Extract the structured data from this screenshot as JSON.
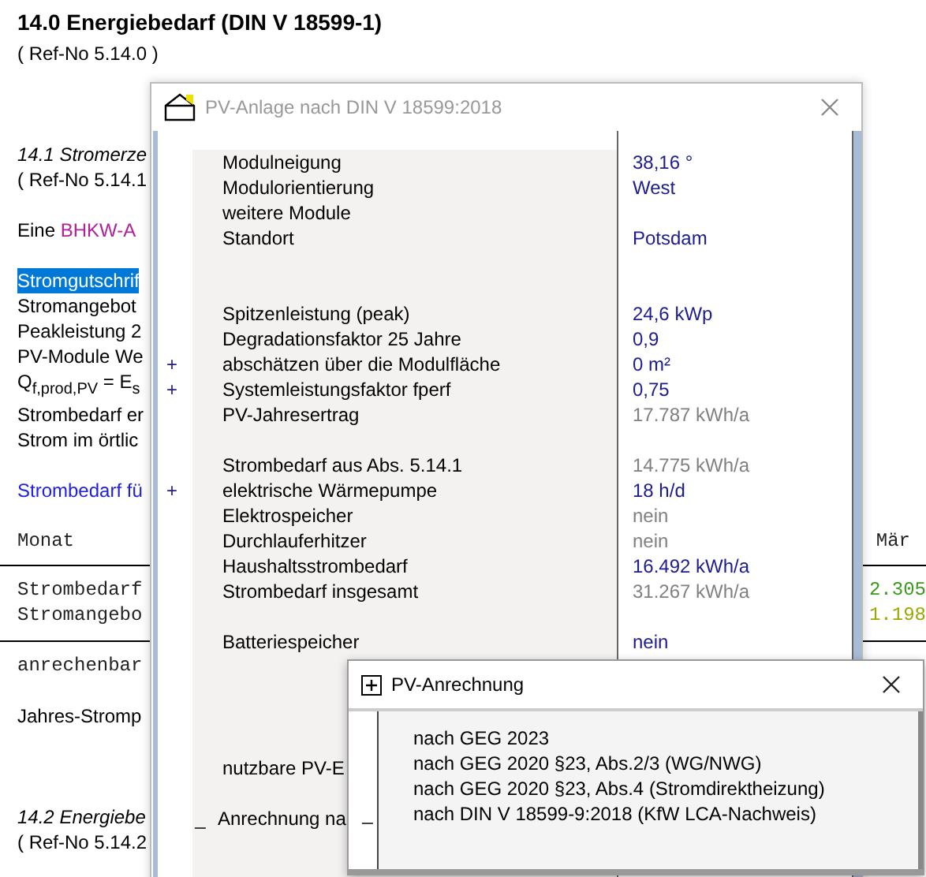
{
  "document": {
    "heading": "14.0 Energiebedarf (DIN V 18599-1)",
    "heading_ref": "( Ref-No 5.14.0 )",
    "subsection": {
      "title": "14.1 Stromerze",
      "ref": "( Ref-No 5.14.1"
    },
    "intro_text": "Eine",
    "intro_link": "BHKW-A",
    "lines": [
      {
        "text": "Stromgutschrif",
        "selected": true
      },
      {
        "text": "Stromangebot",
        "selected": false
      },
      {
        "text": "Peakleistung 2",
        "selected": false
      },
      {
        "text": "PV-Module We",
        "selected": false
      },
      {
        "text": "Q$_{f,prod,PV}$ = E$_{s}$",
        "selected": false
      },
      {
        "text": "Strombedarf er",
        "selected": false
      },
      {
        "text": "Strom im örtlic",
        "selected": false
      }
    ],
    "link_line": "Strombedarf fü",
    "table": {
      "header": {
        "label": "Monat",
        "month": "Mär"
      },
      "rows": [
        {
          "label": "Strombedarf",
          "value": "2.305",
          "color": "#3c9a1c"
        },
        {
          "label": "Stromangebo",
          "value": "1.198",
          "color": "#9aa800"
        }
      ],
      "total_label": "anrechenbar"
    },
    "yearly": "Jahres-Stromp",
    "next_section": {
      "title": "14.2 Energiebe",
      "ref": "( Ref-No 5.14.2"
    }
  },
  "dialog": {
    "title": "PV-Anlage nach DIN V 18599:2018",
    "groups": [
      {
        "rows": [
          {
            "label": "Modulneigung",
            "value": "38,16 °",
            "kind": "input"
          },
          {
            "label": "Modulorientierung",
            "value": "West",
            "kind": "input"
          },
          {
            "label": "weitere Module",
            "kind": "plain"
          },
          {
            "label": "Standort",
            "value": "Potsdam",
            "kind": "input"
          }
        ]
      },
      {
        "rows": [
          {
            "label": "Spitzenleistung (peak)",
            "value": "24,6 kWp",
            "kind": "input"
          },
          {
            "label": "Degradationsfaktor 25 Jahre",
            "value": "0,9",
            "kind": "input"
          },
          {
            "label": "abschätzen über die Modulfläche",
            "marker": "+",
            "value": "0 m²",
            "kind": "input"
          },
          {
            "label": "Systemleistungsfaktor fperf",
            "marker": "+",
            "value": "0,75",
            "kind": "input"
          },
          {
            "label": "PV-Jahresertrag",
            "value": "17.787 kWh/a",
            "kind": "computed"
          }
        ]
      },
      {
        "rows": [
          {
            "label": "Strombedarf aus Abs. 5.14.1",
            "value": "14.775 kWh/a",
            "kind": "computed"
          },
          {
            "label": "elektrische Wärmepumpe",
            "marker": "+",
            "value": "18 h/d",
            "kind": "input"
          },
          {
            "label": "Elektrospeicher",
            "value": "nein",
            "kind": "computed"
          },
          {
            "label": "Durchlauferhitzer",
            "value": "nein",
            "kind": "computed"
          },
          {
            "label": "Haushaltsstrombedarf",
            "value": "16.492 kWh/a",
            "kind": "input"
          },
          {
            "label": "Strombedarf insgesamt",
            "value": "31.267 kWh/a",
            "kind": "computed"
          }
        ]
      },
      {
        "rows": [
          {
            "label": "Batteriespeicher",
            "value": "nein",
            "kind": "input"
          }
        ]
      },
      {
        "rows": [
          {
            "label": "nutzbare PV-E",
            "kind": "plain"
          }
        ]
      },
      {
        "rows": [
          {
            "label": "Anrechnung na",
            "marker": "_",
            "kind": "section"
          }
        ]
      }
    ]
  },
  "popup": {
    "title": "PV-Anrechnung",
    "items": [
      {
        "text": "nach GEG 2023"
      },
      {
        "text": "nach GEG 2020 §23, Abs.2/3 (WG/NWG)"
      },
      {
        "text": "nach GEG 2020 §23, Abs.4 (Stromdirektheizung)"
      },
      {
        "text": "nach DIN V 18599-9:2018 (KfW LCA-Nachweis)",
        "marker": "_"
      }
    ]
  }
}
